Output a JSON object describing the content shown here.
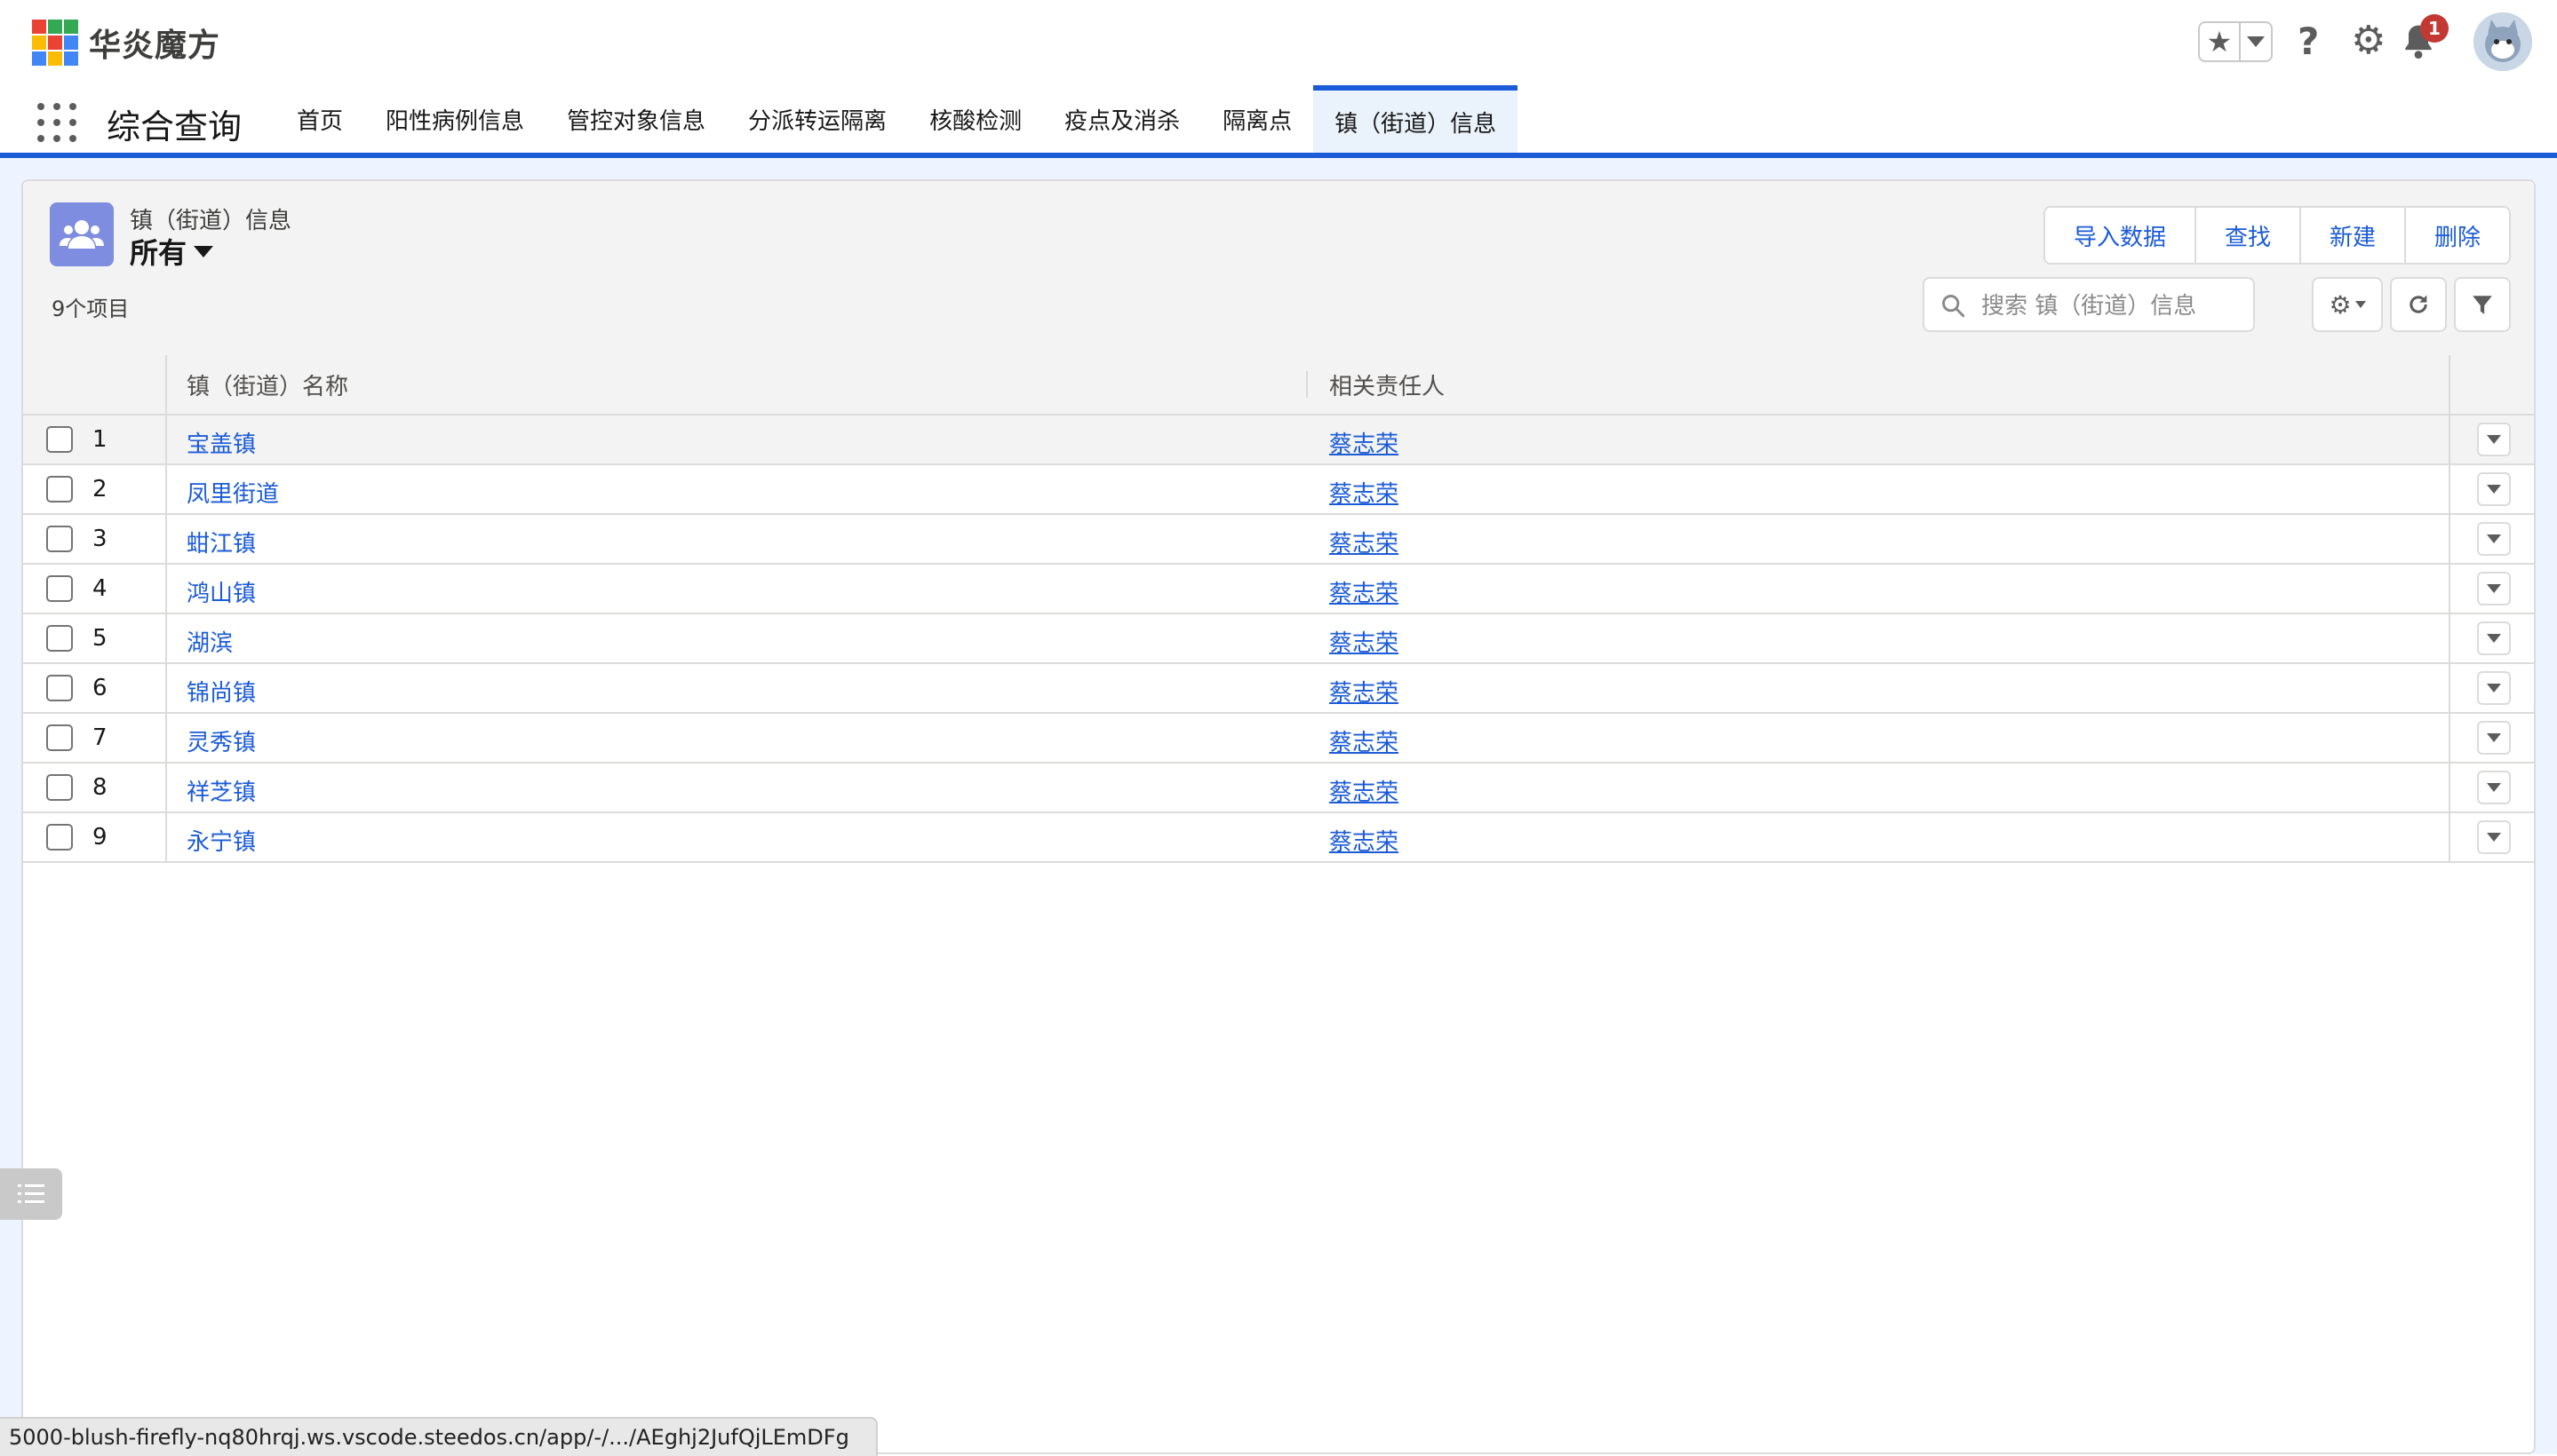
{
  "brand": {
    "name": "华炎魔方",
    "logo_colors": [
      "#ea4335",
      "#34a853",
      "#fbbc05",
      "#4285f4"
    ]
  },
  "header": {
    "favorites_icon": "star-icon",
    "help_icon": "help-icon",
    "settings_icon": "gear-icon",
    "notifications_icon": "bell-icon",
    "notification_count": "1",
    "avatar_icon": "avatar"
  },
  "app": {
    "name": "综合查询",
    "tabs": [
      {
        "label": "首页"
      },
      {
        "label": "阳性病例信息"
      },
      {
        "label": "管控对象信息"
      },
      {
        "label": "分派转运隔离"
      },
      {
        "label": "核酸检测"
      },
      {
        "label": "疫点及消杀"
      },
      {
        "label": "隔离点"
      },
      {
        "label": "镇（街道）信息",
        "active": true
      }
    ]
  },
  "list": {
    "object_label": "镇（街道）信息",
    "view_name": "所有",
    "item_count": "9个项目",
    "actions": {
      "import": "导入数据",
      "find": "查找",
      "new": "新建",
      "delete": "删除"
    },
    "search_placeholder": "搜索 镇（街道）信息",
    "columns": {
      "name": "镇（街道）名称",
      "owner": "相关责任人"
    },
    "rows": [
      {
        "num": "1",
        "name": "宝盖镇",
        "owner": "蔡志荣"
      },
      {
        "num": "2",
        "name": "凤里街道",
        "owner": "蔡志荣"
      },
      {
        "num": "3",
        "name": "蚶江镇",
        "owner": "蔡志荣"
      },
      {
        "num": "4",
        "name": "鸿山镇",
        "owner": "蔡志荣"
      },
      {
        "num": "5",
        "name": "湖滨",
        "owner": "蔡志荣"
      },
      {
        "num": "6",
        "name": "锦尚镇",
        "owner": "蔡志荣"
      },
      {
        "num": "7",
        "name": "灵秀镇",
        "owner": "蔡志荣"
      },
      {
        "num": "8",
        "name": "祥芝镇",
        "owner": "蔡志荣"
      },
      {
        "num": "9",
        "name": "永宁镇",
        "owner": "蔡志荣"
      }
    ]
  },
  "status_bar": {
    "url": "5000-blush-firefly-nq80hrqj.ws.vscode.steedos.cn/app/-/.../AEghj2JufQjLEmDFg"
  },
  "colors": {
    "accent": "#1b5bd7",
    "object_icon_bg": "#7f8de1",
    "badge": "#c23934"
  }
}
